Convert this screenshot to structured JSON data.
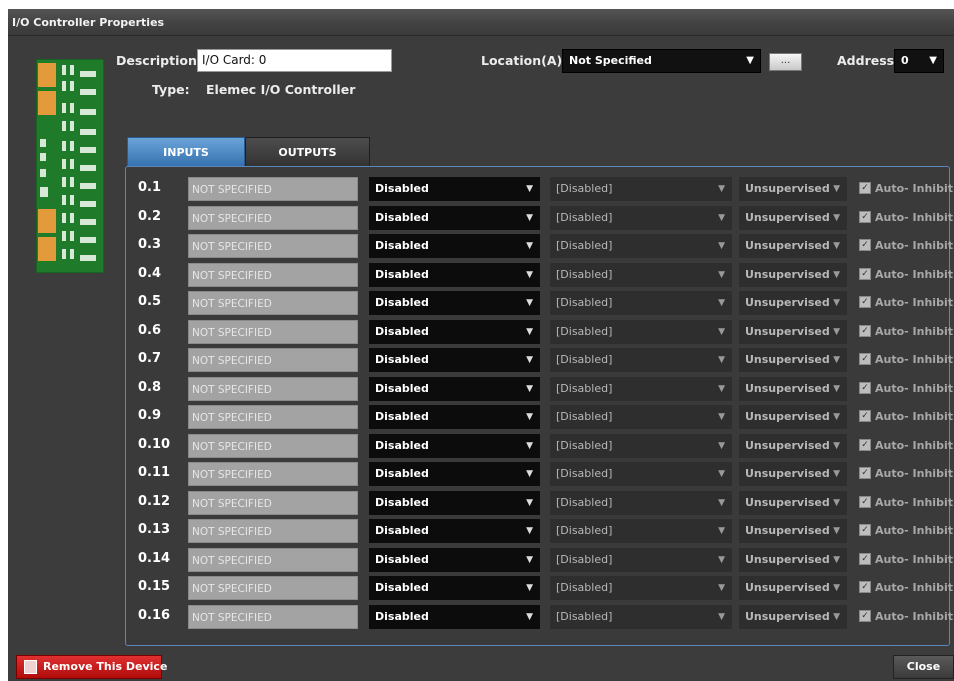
{
  "window": {
    "title": "I/O Controller Properties"
  },
  "header": {
    "description_label": "Description:",
    "description_value": "I/O Card: 0",
    "type_label": "Type:",
    "type_value": "Elemec I/O Controller",
    "location_label": "Location(A):",
    "location_value": "Not Specified",
    "location_button": "...",
    "address_label": "Address:",
    "address_value": "0"
  },
  "tabs": [
    {
      "label": "INPUTS",
      "active": true
    },
    {
      "label": "OUTPUTS",
      "active": false
    }
  ],
  "rows": [
    {
      "num": "0.1",
      "name": "NOT SPECIFIED",
      "mode": "Disabled",
      "function": "[Disabled]",
      "supervision": "Unsupervised",
      "auto_inhibit": "Auto- Inhibit"
    },
    {
      "num": "0.2",
      "name": "NOT SPECIFIED",
      "mode": "Disabled",
      "function": "[Disabled]",
      "supervision": "Unsupervised",
      "auto_inhibit": "Auto- Inhibit"
    },
    {
      "num": "0.3",
      "name": "NOT SPECIFIED",
      "mode": "Disabled",
      "function": "[Disabled]",
      "supervision": "Unsupervised",
      "auto_inhibit": "Auto- Inhibit"
    },
    {
      "num": "0.4",
      "name": "NOT SPECIFIED",
      "mode": "Disabled",
      "function": "[Disabled]",
      "supervision": "Unsupervised",
      "auto_inhibit": "Auto- Inhibit"
    },
    {
      "num": "0.5",
      "name": "NOT SPECIFIED",
      "mode": "Disabled",
      "function": "[Disabled]",
      "supervision": "Unsupervised",
      "auto_inhibit": "Auto- Inhibit"
    },
    {
      "num": "0.6",
      "name": "NOT SPECIFIED",
      "mode": "Disabled",
      "function": "[Disabled]",
      "supervision": "Unsupervised",
      "auto_inhibit": "Auto- Inhibit"
    },
    {
      "num": "0.7",
      "name": "NOT SPECIFIED",
      "mode": "Disabled",
      "function": "[Disabled]",
      "supervision": "Unsupervised",
      "auto_inhibit": "Auto- Inhibit"
    },
    {
      "num": "0.8",
      "name": "NOT SPECIFIED",
      "mode": "Disabled",
      "function": "[Disabled]",
      "supervision": "Unsupervised",
      "auto_inhibit": "Auto- Inhibit"
    },
    {
      "num": "0.9",
      "name": "NOT SPECIFIED",
      "mode": "Disabled",
      "function": "[Disabled]",
      "supervision": "Unsupervised",
      "auto_inhibit": "Auto- Inhibit"
    },
    {
      "num": "0.10",
      "name": "NOT SPECIFIED",
      "mode": "Disabled",
      "function": "[Disabled]",
      "supervision": "Unsupervised",
      "auto_inhibit": "Auto- Inhibit"
    },
    {
      "num": "0.11",
      "name": "NOT SPECIFIED",
      "mode": "Disabled",
      "function": "[Disabled]",
      "supervision": "Unsupervised",
      "auto_inhibit": "Auto- Inhibit"
    },
    {
      "num": "0.12",
      "name": "NOT SPECIFIED",
      "mode": "Disabled",
      "function": "[Disabled]",
      "supervision": "Unsupervised",
      "auto_inhibit": "Auto- Inhibit"
    },
    {
      "num": "0.13",
      "name": "NOT SPECIFIED",
      "mode": "Disabled",
      "function": "[Disabled]",
      "supervision": "Unsupervised",
      "auto_inhibit": "Auto- Inhibit"
    },
    {
      "num": "0.14",
      "name": "NOT SPECIFIED",
      "mode": "Disabled",
      "function": "[Disabled]",
      "supervision": "Unsupervised",
      "auto_inhibit": "Auto- Inhibit"
    },
    {
      "num": "0.15",
      "name": "NOT SPECIFIED",
      "mode": "Disabled",
      "function": "[Disabled]",
      "supervision": "Unsupervised",
      "auto_inhibit": "Auto- Inhibit"
    },
    {
      "num": "0.16",
      "name": "NOT SPECIFIED",
      "mode": "Disabled",
      "function": "[Disabled]",
      "supervision": "Unsupervised",
      "auto_inhibit": "Auto- Inhibit"
    }
  ],
  "footer": {
    "remove_label": "Remove This Device",
    "close_label": "Close"
  },
  "icons": {
    "device_image": "circuit-board-icon",
    "remove": "trash-icon",
    "dropdown": "chevron-down-icon"
  },
  "colors": {
    "window_bg": "#3c3c3c",
    "tab_active": "#4a88c6",
    "panel_border": "#5b86b5",
    "remove_button": "#d42020",
    "board_green": "#1f7a2a"
  }
}
